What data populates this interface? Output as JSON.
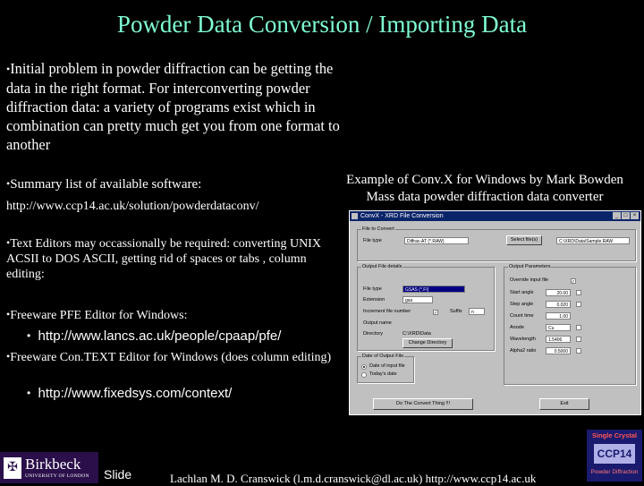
{
  "title": "Powder Data Conversion / Importing Data",
  "bullet": "•",
  "intro": "Initial problem in powder diffraction can be getting the data in the right format.  For interconverting powder diffraction data: a variety of programs exist which in combination can pretty much get you from one format to another",
  "summary_label": "Summary list of available software:",
  "summary_url": "http://www.ccp14.ac.uk/solution/powderdataconv/",
  "caption_line1": "Example of Conv.X for Windows by Mark Bowden",
  "caption_line2": "Mass data powder diffraction data converter",
  "text_editors": "Text Editors may occassionally be required: converting UNIX ACSII to DOS ASCII, getting rid of spaces or tabs , column editing:",
  "pfe_label": "Freeware PFE Editor for Windows:",
  "pfe_url": "http://www.lancs.ac.uk/people/cpaap/pfe/",
  "context_label": "Freeware Con.TEXT Editor for Windows (does column editing)",
  "context_url": "http://www.fixedsys.com/context/",
  "window": {
    "title": "ConvX - XRD File Conversion",
    "file_group": "File to Convert",
    "file_type_label": "File type",
    "file_type_value": "Diffrac-AT  (*.RAW)",
    "select_button": "Select file(s)",
    "path_value": "C:\\XRD\\Data\\Sample.RAW",
    "output_group": "Output File details",
    "out_type_label": "File type",
    "out_type_value": "GSAS (*.FI)",
    "extension_label": "Extension",
    "extension_value": "gsa",
    "increment_label": "Increment file number",
    "suffix_label": "Suffix",
    "suffix_value": "n",
    "name_label": "Output name",
    "directory_label": "Directory",
    "directory_value": "C:\\XRD\\Data",
    "change_dir_button": "Change Directory",
    "date_group": "Date of Output File",
    "date_opt1": "Date of input file",
    "date_opt2": "Today's date",
    "params_group": "Output Parameters",
    "p_override": "Override input file",
    "p_start": "Start angle",
    "p_start_val": "20.00",
    "p_step": "Step angle",
    "p_step_val": "0.020",
    "p_count": "Count time",
    "p_count_val": "1.00",
    "p_anode": "Anode",
    "p_anode_val": "Cu",
    "p_wavelength": "Wavelength",
    "p_wavelength_val": "1.5406",
    "p_align": "Alpha2 ratio",
    "p_align_val": "0.5000",
    "convert_button": "Do The Convert Thing !!!",
    "exit_button": "Exit"
  },
  "birkbeck_name": "Birkbeck",
  "birkbeck_sub": "UNIVERSITY OF LONDON",
  "slide_label": "Slide",
  "footer": "Lachlan M. D. Cranswick (l.m.d.cranswick@dl.ac.uk) http://www.ccp14.ac.uk",
  "ccp_line1": "Single Crystal",
  "ccp_logo": "CCP14",
  "ccp_line2": "Powder Diffraction",
  "colors": {
    "title": "#7fffd4",
    "background": "#000000",
    "titlebar": "#0a246a"
  }
}
